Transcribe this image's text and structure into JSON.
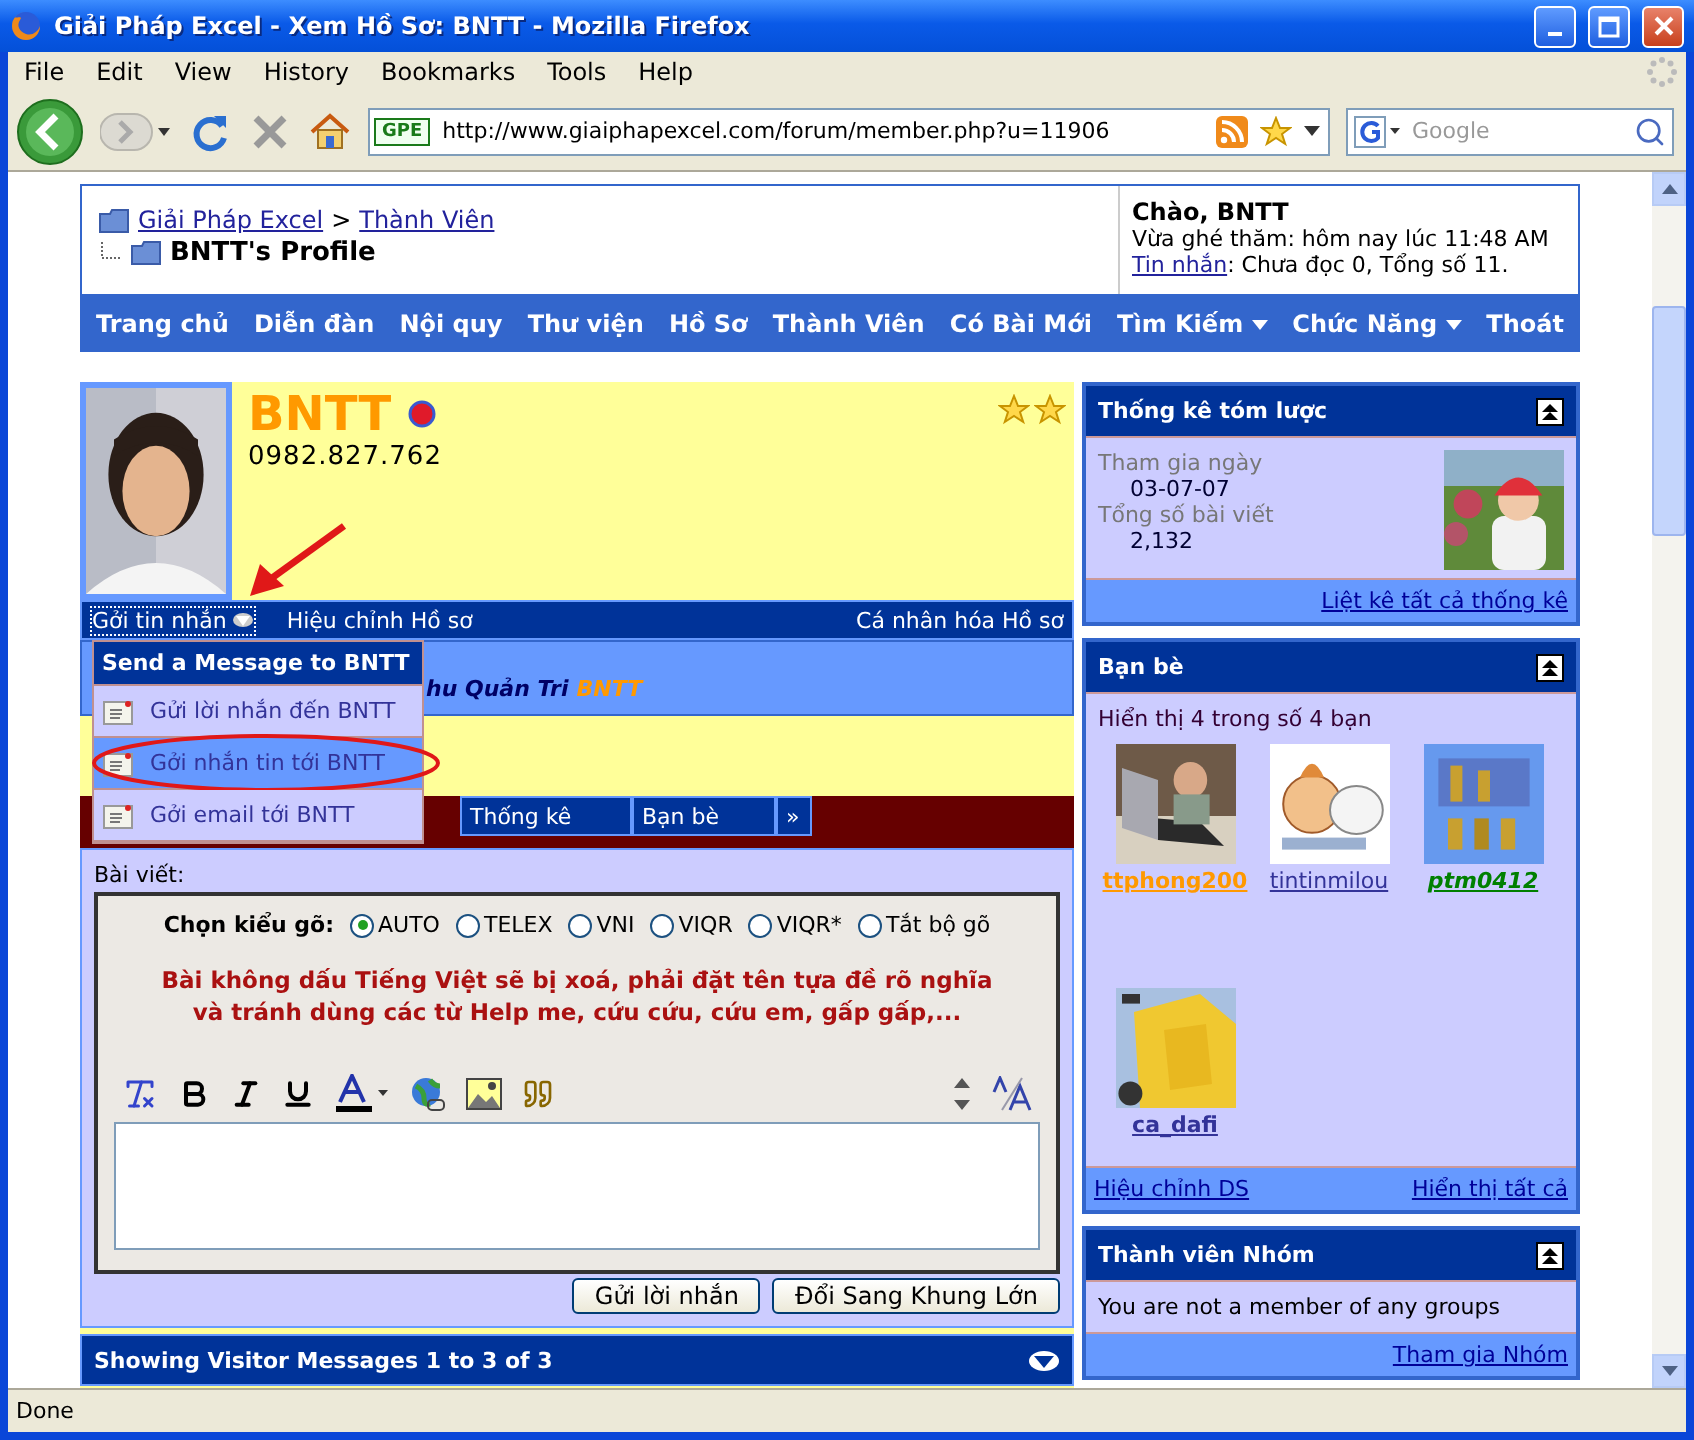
{
  "window": {
    "title": "Giải Pháp Excel - Xem Hồ Sơ: BNTT - Mozilla Firefox"
  },
  "menu": [
    "File",
    "Edit",
    "View",
    "History",
    "Bookmarks",
    "Tools",
    "Help"
  ],
  "toolbar": {
    "site_badge": "GPE",
    "url": "http://www.giaiphapexcel.com/forum/member.php?u=11906",
    "search": {
      "placeholder": "Google"
    }
  },
  "header": {
    "breadcrumb": [
      "Giải Pháp Excel",
      "Thành Viên"
    ],
    "separator": ">",
    "page_title": "BNTT's Profile",
    "greeting": "Chào, BNTT",
    "last_visit": "Vừa ghé thăm: hôm nay lúc 11:48 AM",
    "messages_link": "Tin nhắn",
    "messages_text": ": Chưa đọc 0, Tổng số 11."
  },
  "nav": [
    {
      "label": "Trang chủ",
      "dropdown": false
    },
    {
      "label": "Diễn đàn",
      "dropdown": false
    },
    {
      "label": "Nội quy",
      "dropdown": false
    },
    {
      "label": "Thư viện",
      "dropdown": false
    },
    {
      "label": "Hồ Sơ",
      "dropdown": false
    },
    {
      "label": "Thành Viên",
      "dropdown": false
    },
    {
      "label": "Có Bài Mới",
      "dropdown": false
    },
    {
      "label": "Tìm Kiếm",
      "dropdown": true
    },
    {
      "label": "Chức Năng",
      "dropdown": true
    },
    {
      "label": "Thoát",
      "dropdown": false
    }
  ],
  "profile": {
    "username": "BNTT",
    "online": true,
    "phone": "0982.827.762",
    "rank_icons": [
      {
        "kind": "star"
      },
      {
        "kind": "star"
      }
    ],
    "actions": [
      {
        "label": "Gởi tin nhắn",
        "dropdown": true
      },
      {
        "label": "Hiệu chỉnh Hồ sơ",
        "dropdown": false
      }
    ],
    "customize": "Cá nhân hóa Hồ sơ",
    "usergroup_title": "hu Quản Tri",
    "usergroup_name": "BNTT",
    "tabs": [
      {
        "label": "Thống kê",
        "selected": false
      },
      {
        "label": "Bạn bè",
        "selected": false
      },
      {
        "label": "»",
        "selected": false
      }
    ]
  },
  "message_menu": {
    "title": "Send a Message to BNTT",
    "items": [
      {
        "label": "Gửi lời nhắn đến BNTT",
        "selected": false
      },
      {
        "label": "Gởi nhắn tin tới BNTT",
        "selected": true
      },
      {
        "label": "Gởi email tới BNTT",
        "selected": false
      }
    ]
  },
  "editor": {
    "label": "Bài viết:",
    "input_method_label": "Chọn kiểu gõ:",
    "input_methods": [
      {
        "label": "AUTO",
        "selected": true
      },
      {
        "label": "TELEX",
        "selected": false
      },
      {
        "label": "VNI",
        "selected": false
      },
      {
        "label": "VIQR",
        "selected": false
      },
      {
        "label": "VIQR*",
        "selected": false
      },
      {
        "label": "Tắt bộ gõ",
        "selected": false
      }
    ],
    "warning_lines": [
      "Bài không dấu Tiếng Việt sẽ bị xoá, phải đặt tên tựa đề rõ nghĩa",
      "và tránh dùng các từ Help me, cứu cứu, cứu em, gấp gấp,..."
    ],
    "buttons": [
      "Gửi lời nhắn",
      "Đổi Sang Khung Lớn"
    ]
  },
  "visitor_messages": {
    "title": "Showing Visitor Messages 1 to 3 of 3"
  },
  "sidebar": {
    "stats": {
      "title": "Thống kê tóm lược",
      "rows": [
        {
          "label": "Tham gia ngày",
          "value": "03-07-07"
        },
        {
          "label": "Tổng số bài viết",
          "value": "2,132"
        }
      ],
      "link": "Liệt kê tất cả thống kê"
    },
    "friends": {
      "title": "Bạn bè",
      "summary": "Hiển thị 4 trong số 4 bạn",
      "items": [
        {
          "name": "ttphong200",
          "color": "#ff9900",
          "bold": true,
          "italic": false
        },
        {
          "name": "tintinmilou",
          "color": "#333399",
          "bold": false,
          "italic": false
        },
        {
          "name": "ptm0412",
          "color": "#008000",
          "bold": true,
          "italic": true
        },
        {
          "name": "ca_dafi",
          "color": "#333399",
          "bold": true,
          "italic": false
        }
      ],
      "edit_link": "Hiệu chỉnh DS",
      "all_link": "Hiển thị tất cả"
    },
    "groups": {
      "title": "Thành viên Nhóm",
      "text": "You are not a member of any groups",
      "link": "Tham gia Nhóm"
    }
  },
  "status_bar": "Done"
}
